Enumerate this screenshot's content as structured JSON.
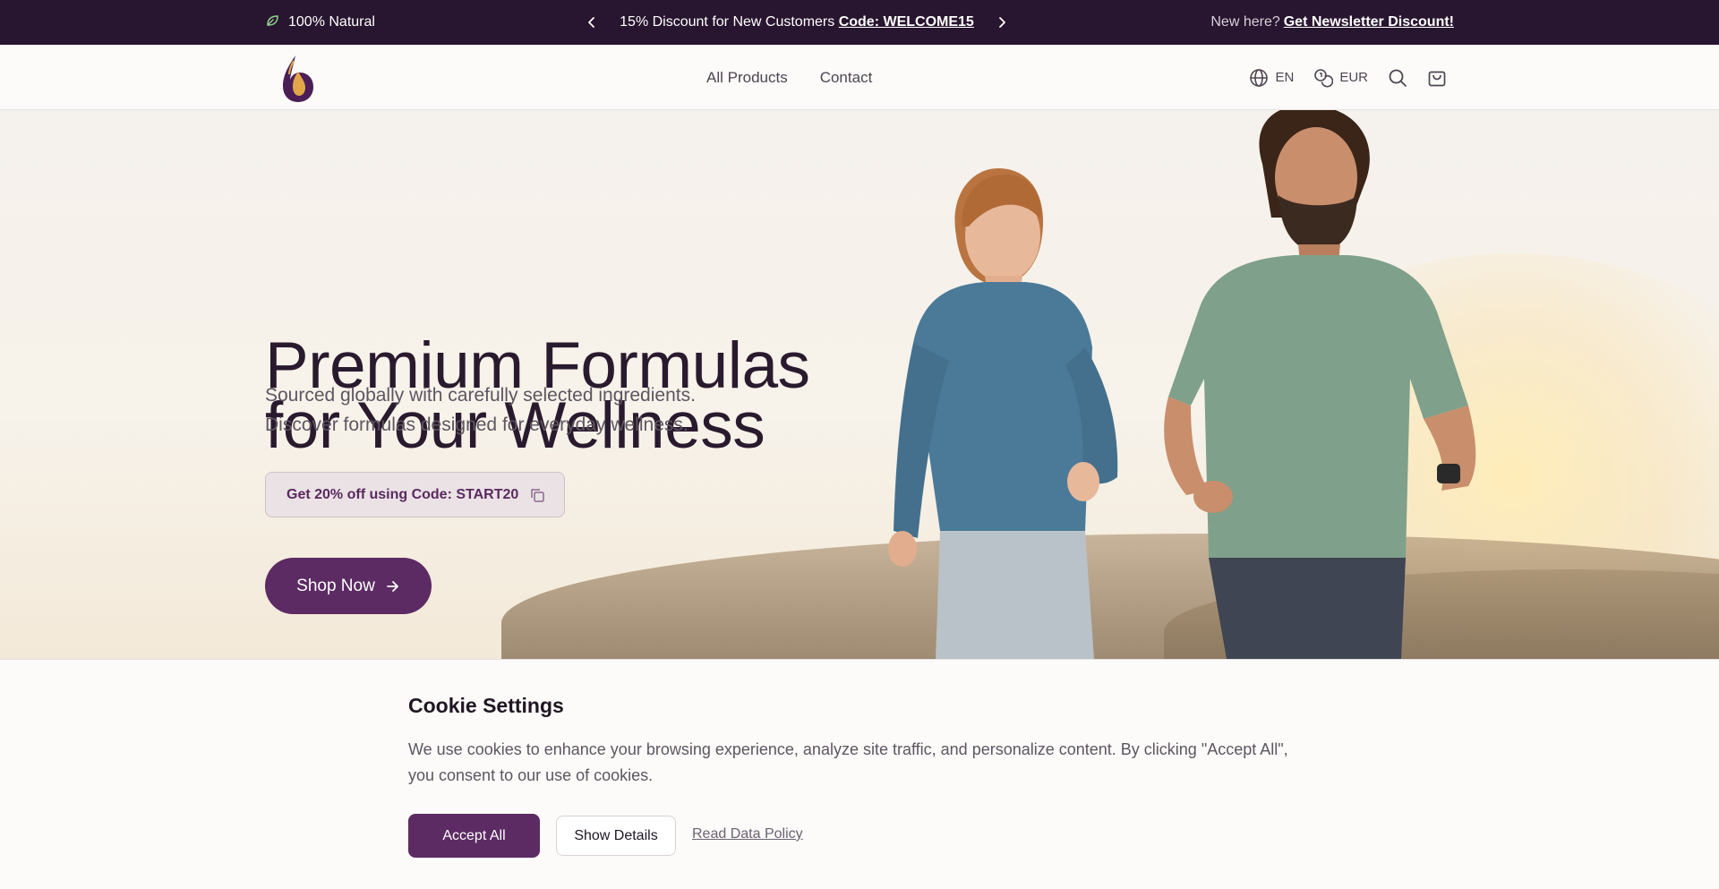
{
  "topbar": {
    "left_text": "100% Natural",
    "left_icon": "leaf-icon",
    "center_text": "15% Discount for New Customers",
    "center_code": "Code: WELCOME15",
    "right_text": "New here?",
    "right_link": "Get Newsletter Discount!"
  },
  "header": {
    "nav": [
      "All Products",
      "Contact"
    ],
    "language": "EN",
    "currency": "EUR"
  },
  "hero": {
    "title_line1": "Premium Formulas",
    "title_line2": "for Your Wellness",
    "subtitle_line1": "Sourced globally with carefully selected ingredients.",
    "subtitle_line2": "Discover formulas designed for everyday wellness.",
    "promo": "Get 20% off using Code: START20",
    "cta": "Shop Now"
  },
  "cookie": {
    "title": "Cookie Settings",
    "text": "We use cookies to enhance your browsing experience, analyze site traffic, and personalize content. By clicking \"Accept All\", you consent to our use of cookies.",
    "accept": "Accept All",
    "details": "Show Details",
    "policy": "Read Data Policy"
  },
  "colors": {
    "brand": "#5c2b63",
    "topbar": "#28152f",
    "leaf": "#8fd18b"
  }
}
